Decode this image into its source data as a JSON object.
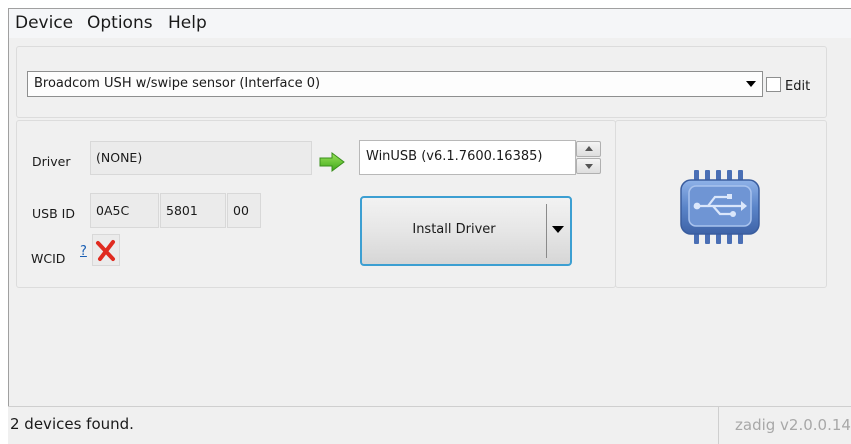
{
  "menu": {
    "device": "Device",
    "options": "Options",
    "help": "Help"
  },
  "device_select": {
    "selected": "Broadcom USH w/swipe sensor (Interface 0)",
    "edit_label": "Edit",
    "edit_checked": false
  },
  "driver": {
    "label": "Driver",
    "current": "(NONE)",
    "target": "WinUSB (v6.1.7600.16385)"
  },
  "usb_id": {
    "label": "USB ID",
    "vid": "0A5C",
    "pid": "5801",
    "mi": "00"
  },
  "wcid": {
    "label": "WCID",
    "help_link": "?",
    "status_icon": "red-x-icon"
  },
  "install_button": {
    "label": "Install Driver"
  },
  "icons": {
    "arrow": "green-right-arrow-icon",
    "device": "usb-device-icon"
  },
  "status": {
    "message": "2 devices found.",
    "version": "zadig v2.0.0.14"
  },
  "colors": {
    "button_border": "#3c9fd2",
    "arrow": "#5cc82b",
    "x_mark": "#e02b20",
    "usb_icon": "#5b85c9"
  }
}
